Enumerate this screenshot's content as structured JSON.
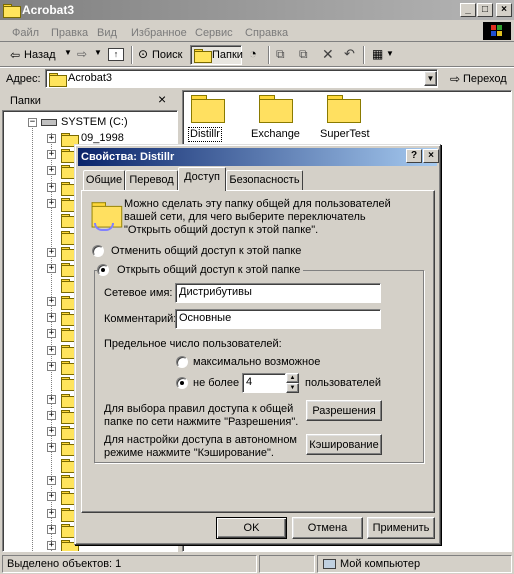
{
  "window": {
    "title": "Acrobat3"
  },
  "menu": [
    "Файл",
    "Правка",
    "Вид",
    "Избранное",
    "Сервис",
    "Справка"
  ],
  "toolbar": {
    "back_label": "Назад",
    "search_label": "Поиск",
    "folders_label": "Папки"
  },
  "address": {
    "label": "Адрес:",
    "value": "Acrobat3",
    "go_label": "Переход"
  },
  "folders_pane": {
    "title": "Папки",
    "close_glyph": "×",
    "tree": [
      {
        "label": "SYSTEM (C:)",
        "expander": "−"
      },
      {
        "label": "09_1998",
        "expander": "+"
      }
    ]
  },
  "files": [
    {
      "name": "Distillr"
    },
    {
      "name": "Exchange"
    },
    {
      "name": "SuperTest"
    }
  ],
  "dialog": {
    "title": "Свойства: Distillr",
    "help_glyph": "?",
    "close_glyph": "×",
    "tabs": [
      {
        "label": "Общие",
        "active": false
      },
      {
        "label": "Перевод",
        "active": false
      },
      {
        "label": "Доступ",
        "active": true
      },
      {
        "label": "Безопасность",
        "active": false
      }
    ],
    "intro_text": [
      "Можно сделать эту папку общей для пользователей",
      "вашей сети, для чего выберите переключатель",
      "\"Открыть общий доступ к этой папке\"."
    ],
    "option_no_share": "Отменить общий доступ к этой папке",
    "option_share": "Открыть общий доступ к этой папке",
    "share_name_label": "Сетевое имя:",
    "share_name_value": "Дистрибутивы",
    "comment_label": "Комментарий:",
    "comment_value": "Основные",
    "user_limit_label": "Предельное число пользователей:",
    "max_allowed_label": "максимально возможное",
    "allow_label": "не более",
    "allow_value": "4",
    "users_label": "пользователей",
    "permissions_text": [
      "Для выбора правил доступа к общей",
      "папке по сети нажмите \"Разрешения\"."
    ],
    "permissions_button": "Разрешения",
    "caching_text": [
      "Для настройки доступа в автономном",
      "режиме нажмите \"Кэширование\"."
    ],
    "caching_button": "Кэширование",
    "ok_button": "OK",
    "cancel_button": "Отмена",
    "apply_button": "Применить"
  },
  "statusbar": {
    "selected_text": "Выделено объектов: 1",
    "location_text": "Мой компьютер"
  }
}
